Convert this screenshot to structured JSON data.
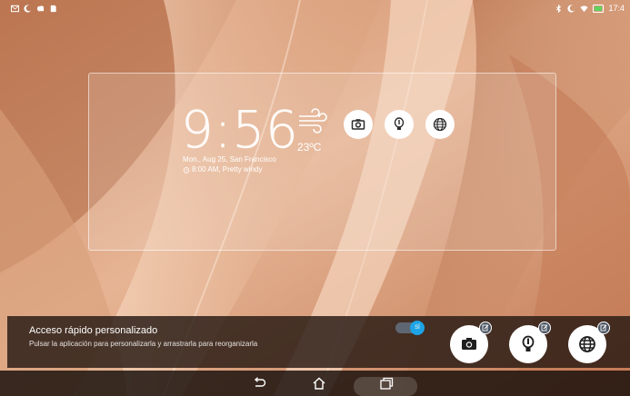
{
  "status_bar": {
    "left_icons": [
      "message-icon",
      "moon-icon",
      "cloud-icon",
      "sd-card-icon"
    ],
    "right_icons": [
      "bluetooth-icon",
      "moon-icon",
      "wifi-icon",
      "battery-icon"
    ],
    "time": "17:4"
  },
  "widget": {
    "clock": "9:56",
    "temperature": "23ºC",
    "date_location": "Mon., Aug 25, San Francisco",
    "alarm": "8:00 AM, Pretty windy",
    "weather_icon": "wind-icon",
    "shortcuts": [
      {
        "icon": "camera-icon"
      },
      {
        "icon": "flashlight-icon"
      },
      {
        "icon": "globe-icon"
      }
    ]
  },
  "quick_access": {
    "title": "Acceso rápido personalizado",
    "subtitle": "Pulsar la aplicación para personalizarla y arrastrarla para reorganizarla",
    "toggle_label": "SÍ",
    "toggle_on": true,
    "apps": [
      {
        "icon": "camera-icon",
        "badge": "edit-icon"
      },
      {
        "icon": "flashlight-icon",
        "badge": "edit-icon"
      },
      {
        "icon": "globe-icon",
        "badge": "edit-icon"
      }
    ]
  },
  "nav_bar": {
    "buttons": [
      "back-icon",
      "home-icon",
      "recents-icon"
    ]
  },
  "colors": {
    "wallpaper_light": "#f1c7a8",
    "wallpaper_dark": "#b86f4a",
    "accent": "#1ea3e6"
  }
}
